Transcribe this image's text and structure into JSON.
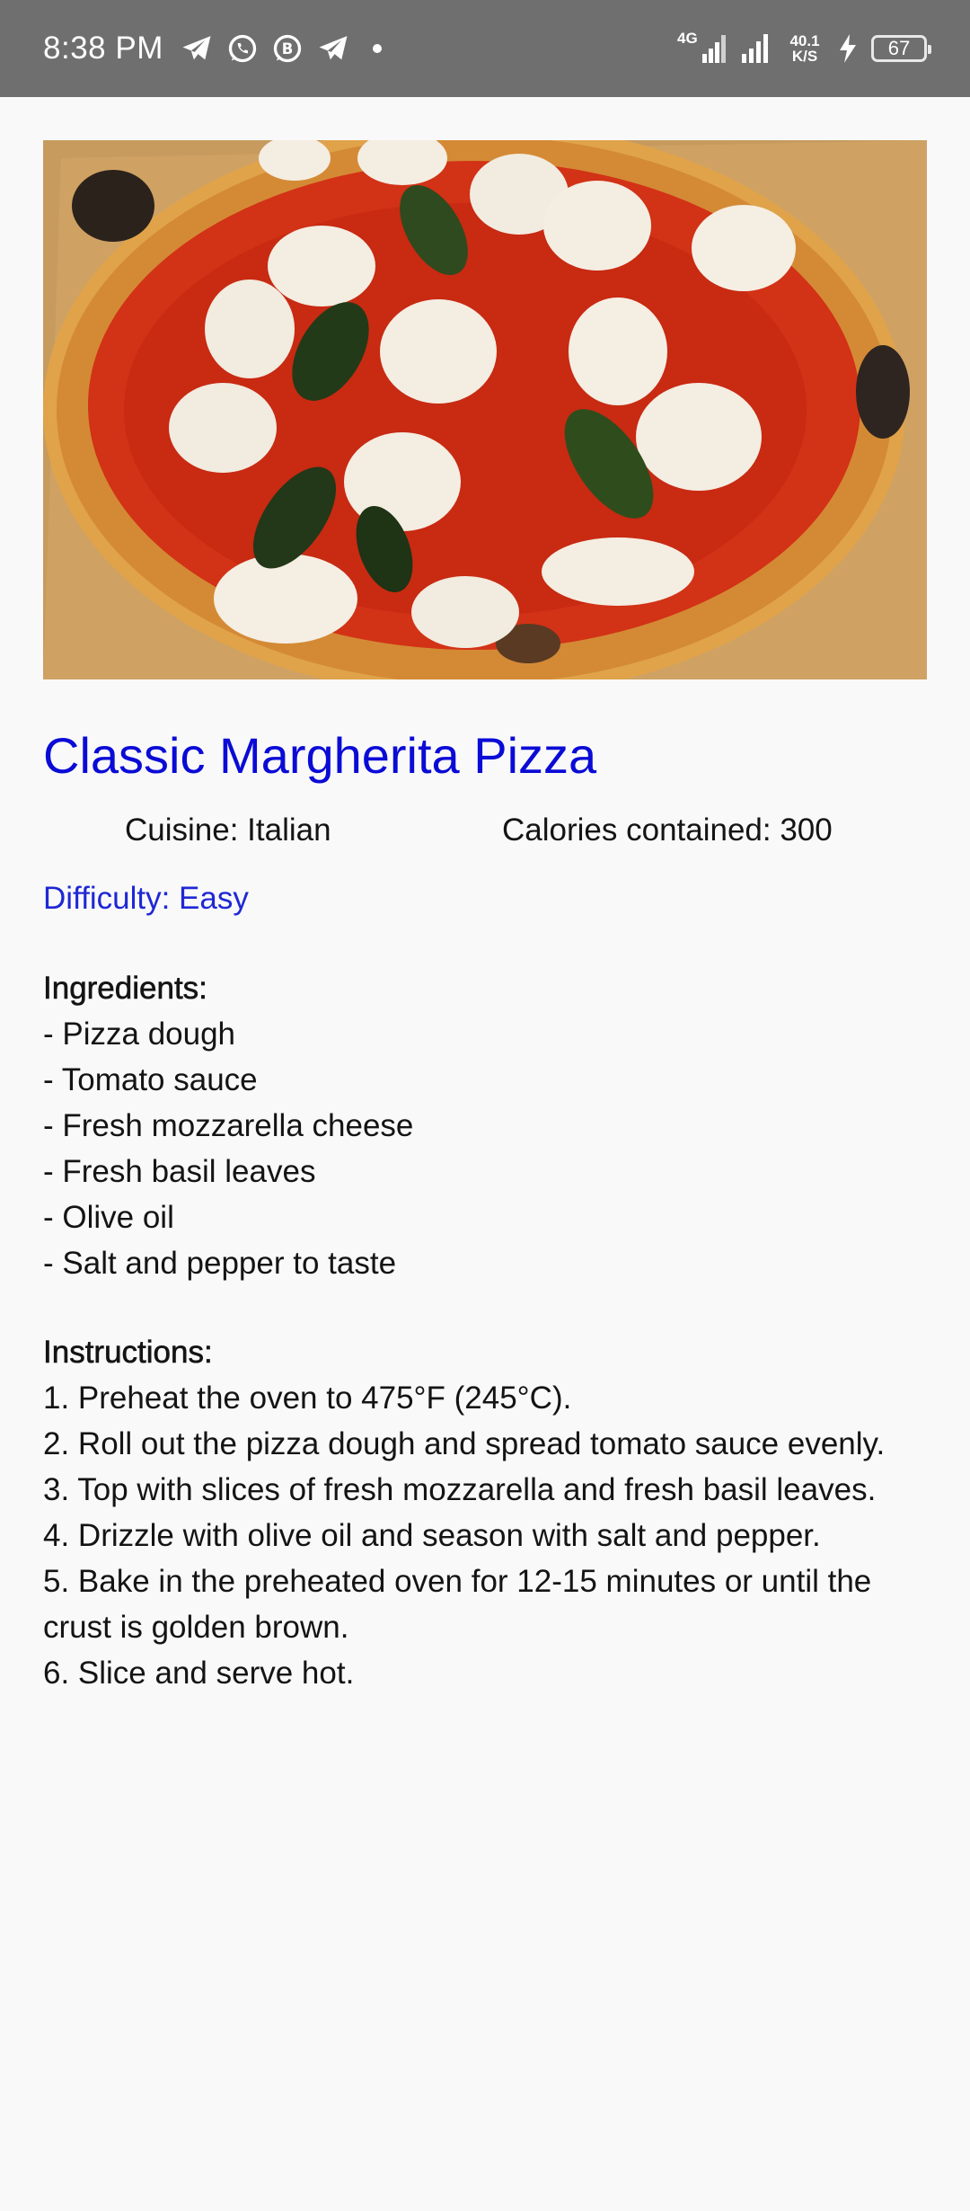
{
  "status_bar": {
    "time": "8:38 PM",
    "network_type": "4G",
    "speed_value": "40.1",
    "speed_unit": "K/S",
    "battery": "67"
  },
  "recipe": {
    "title": "Classic Margherita Pizza",
    "cuisine": "Cuisine: Italian",
    "calories": "Calories contained: 300",
    "difficulty": "Difficulty: Easy",
    "ingredients_heading": "Ingredients:",
    "ingredients": [
      "- Pizza dough",
      "- Tomato sauce",
      "- Fresh mozzarella cheese",
      "- Fresh basil leaves",
      "- Olive oil",
      "- Salt and pepper to taste"
    ],
    "instructions_heading": "Instructions:",
    "instructions": [
      "1. Preheat the oven to 475°F (245°C).",
      "2. Roll out the pizza dough and spread tomato sauce evenly.",
      "3. Top with slices of fresh mozzarella and fresh basil leaves.",
      "4. Drizzle with olive oil and season with salt and pepper.",
      "5. Bake in the preheated oven for 12-15 minutes or until the crust is golden brown.",
      "6. Slice and serve hot."
    ]
  },
  "colors": {
    "title": "#0b0bd6",
    "difficulty": "#1f28d4",
    "status_bar": "#6f6f6f",
    "background": "#f9f9fa"
  }
}
